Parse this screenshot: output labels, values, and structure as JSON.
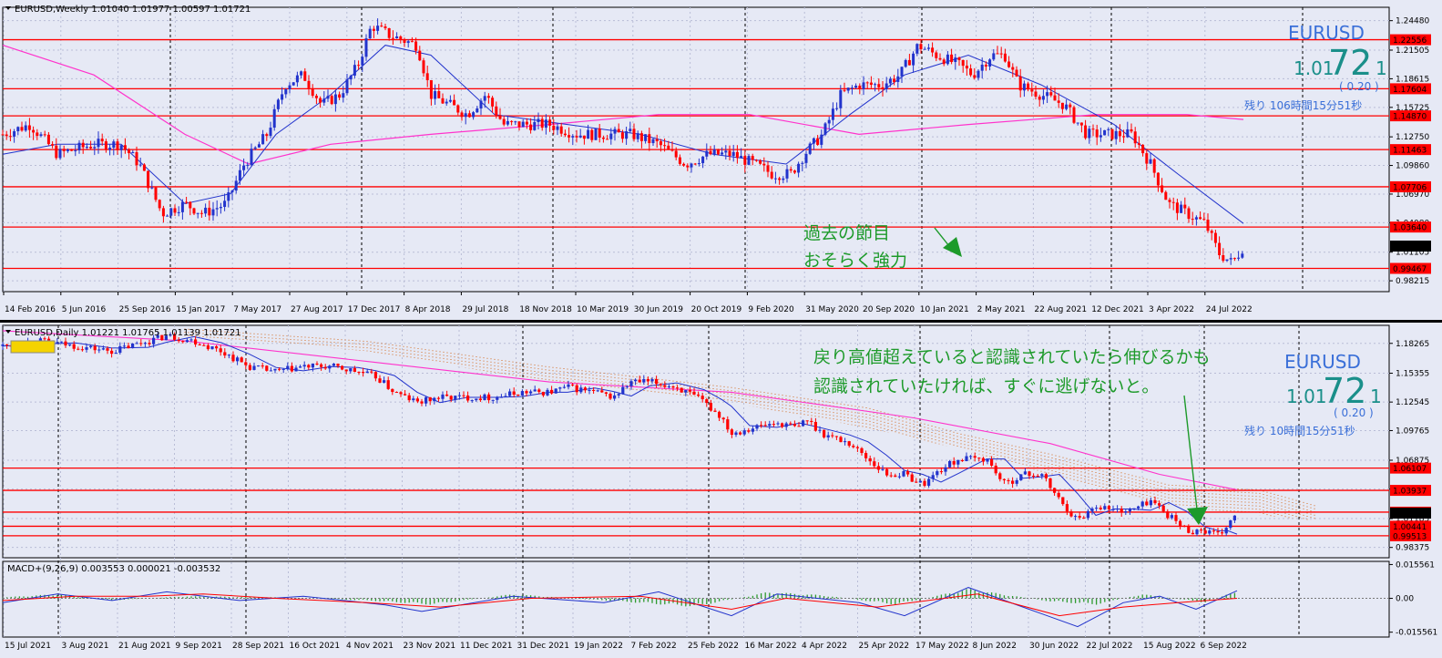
{
  "top_panel": {
    "header": "EURUSD,Weekly  1.01040 1.01977 1.00597 1.01721",
    "symbol": "EURUSD",
    "price_small": "1.01",
    "price_big": "72",
    "price_tail": "1",
    "change": "( 0.20 )",
    "remaining": "残り 106時間15分51秒",
    "annotation_line1": "過去の節目",
    "annotation_line2": "おそらく強力",
    "colors": {
      "levels": "#ff0000",
      "candle_up": "#2233cc",
      "candle_down": "#ff0000",
      "ma_fast": "#2233cc",
      "ma_slow": "#ff33cc",
      "annotation": "#1d9a2a",
      "arrow": "#1d9a2a"
    }
  },
  "bottom_panel": {
    "header": "EURUSD,Daily  1.01221 1.01765 1.01139 1.01721",
    "symbol": "EURUSD",
    "price_small": "1.01",
    "price_big": "72",
    "price_tail": "1",
    "change": "( 0.20 )",
    "remaining": "残り 10時間15分51秒",
    "annotation_line1": "戻り高値超えていると認識されていたら伸びるかも",
    "annotation_line2": "認識されていたければ、すぐに逃げないと。",
    "macd_header": "MACD+(9,26,9) 0.003553 0.000021 -0.003532",
    "colors": {
      "levels": "#ff0000",
      "cloud": "#d2691e",
      "ma": "#ff33cc"
    }
  },
  "chart_data": [
    {
      "type": "candlestick",
      "timeframe": "Weekly",
      "x_tick_labels": [
        "14 Feb 2016",
        "5 Jun 2016",
        "25 Sep 2016",
        "15 Jan 2017",
        "7 May 2017",
        "27 Aug 2017",
        "17 Dec 2017",
        "8 Apr 2018",
        "29 Jul 2018",
        "18 Nov 2018",
        "10 Mar 2019",
        "30 Jun 2019",
        "20 Oct 2019",
        "9 Feb 2020",
        "31 May 2020",
        "20 Sep 2020",
        "10 Jan 2021",
        "2 May 2021",
        "22 Aug 2021",
        "12 Dec 2021",
        "3 Apr 2022",
        "24 Jul 2022"
      ],
      "y_tick_labels": [
        "1.24480",
        "1.21505",
        "1.18615",
        "1.15725",
        "1.12750",
        "1.09860",
        "1.06970",
        "1.04080",
        "1.01105",
        "0.98215"
      ],
      "ylim": [
        0.9712,
        1.2583
      ],
      "level_labels": [
        "1.22556",
        "1.17604",
        "1.14870",
        "1.11463",
        "1.07706",
        "1.03640",
        "0.99467"
      ],
      "current_price_label": "1.01721",
      "close_path": [
        {
          "x": 0,
          "y": 1.13
        },
        {
          "x": 30,
          "y": 1.14
        },
        {
          "x": 60,
          "y": 1.11
        },
        {
          "x": 100,
          "y": 1.12
        },
        {
          "x": 130,
          "y": 1.12
        },
        {
          "x": 150,
          "y": 1.1
        },
        {
          "x": 175,
          "y": 1.05
        },
        {
          "x": 200,
          "y": 1.06
        },
        {
          "x": 220,
          "y": 1.05
        },
        {
          "x": 245,
          "y": 1.06
        },
        {
          "x": 265,
          "y": 1.1
        },
        {
          "x": 290,
          "y": 1.13
        },
        {
          "x": 310,
          "y": 1.18
        },
        {
          "x": 330,
          "y": 1.19
        },
        {
          "x": 350,
          "y": 1.16
        },
        {
          "x": 370,
          "y": 1.17
        },
        {
          "x": 390,
          "y": 1.2
        },
        {
          "x": 405,
          "y": 1.24
        },
        {
          "x": 425,
          "y": 1.23
        },
        {
          "x": 455,
          "y": 1.22
        },
        {
          "x": 470,
          "y": 1.17
        },
        {
          "x": 490,
          "y": 1.16
        },
        {
          "x": 510,
          "y": 1.15
        },
        {
          "x": 530,
          "y": 1.17
        },
        {
          "x": 550,
          "y": 1.14
        },
        {
          "x": 575,
          "y": 1.14
        },
        {
          "x": 600,
          "y": 1.14
        },
        {
          "x": 630,
          "y": 1.13
        },
        {
          "x": 660,
          "y": 1.13
        },
        {
          "x": 690,
          "y": 1.13
        },
        {
          "x": 720,
          "y": 1.12
        },
        {
          "x": 750,
          "y": 1.1
        },
        {
          "x": 775,
          "y": 1.11
        },
        {
          "x": 800,
          "y": 1.11
        },
        {
          "x": 825,
          "y": 1.1
        },
        {
          "x": 845,
          "y": 1.09
        },
        {
          "x": 865,
          "y": 1.09
        },
        {
          "x": 880,
          "y": 1.11
        },
        {
          "x": 900,
          "y": 1.13
        },
        {
          "x": 920,
          "y": 1.17
        },
        {
          "x": 940,
          "y": 1.18
        },
        {
          "x": 965,
          "y": 1.18
        },
        {
          "x": 985,
          "y": 1.19
        },
        {
          "x": 1005,
          "y": 1.22
        },
        {
          "x": 1025,
          "y": 1.21
        },
        {
          "x": 1050,
          "y": 1.2
        },
        {
          "x": 1065,
          "y": 1.19
        },
        {
          "x": 1085,
          "y": 1.21
        },
        {
          "x": 1100,
          "y": 1.21
        },
        {
          "x": 1115,
          "y": 1.18
        },
        {
          "x": 1140,
          "y": 1.17
        },
        {
          "x": 1165,
          "y": 1.16
        },
        {
          "x": 1190,
          "y": 1.13
        },
        {
          "x": 1215,
          "y": 1.13
        },
        {
          "x": 1240,
          "y": 1.13
        },
        {
          "x": 1260,
          "y": 1.1
        },
        {
          "x": 1280,
          "y": 1.06
        },
        {
          "x": 1300,
          "y": 1.05
        },
        {
          "x": 1320,
          "y": 1.04
        },
        {
          "x": 1335,
          "y": 1.01
        },
        {
          "x": 1350,
          "y": 1.0
        },
        {
          "x": 1362,
          "y": 1.017
        }
      ],
      "ma_fast": [
        {
          "x": 0,
          "y": 1.11
        },
        {
          "x": 60,
          "y": 1.12
        },
        {
          "x": 130,
          "y": 1.12
        },
        {
          "x": 200,
          "y": 1.06
        },
        {
          "x": 250,
          "y": 1.07
        },
        {
          "x": 300,
          "y": 1.13
        },
        {
          "x": 360,
          "y": 1.17
        },
        {
          "x": 420,
          "y": 1.22
        },
        {
          "x": 470,
          "y": 1.21
        },
        {
          "x": 540,
          "y": 1.15
        },
        {
          "x": 620,
          "y": 1.14
        },
        {
          "x": 700,
          "y": 1.13
        },
        {
          "x": 780,
          "y": 1.11
        },
        {
          "x": 860,
          "y": 1.1
        },
        {
          "x": 930,
          "y": 1.15
        },
        {
          "x": 990,
          "y": 1.19
        },
        {
          "x": 1060,
          "y": 1.21
        },
        {
          "x": 1140,
          "y": 1.18
        },
        {
          "x": 1220,
          "y": 1.14
        },
        {
          "x": 1290,
          "y": 1.09
        },
        {
          "x": 1362,
          "y": 1.04
        }
      ],
      "ma_slow": [
        {
          "x": 0,
          "y": 1.22
        },
        {
          "x": 100,
          "y": 1.19
        },
        {
          "x": 200,
          "y": 1.13
        },
        {
          "x": 270,
          "y": 1.1
        },
        {
          "x": 360,
          "y": 1.12
        },
        {
          "x": 470,
          "y": 1.13
        },
        {
          "x": 600,
          "y": 1.14
        },
        {
          "x": 720,
          "y": 1.15
        },
        {
          "x": 820,
          "y": 1.15
        },
        {
          "x": 940,
          "y": 1.13
        },
        {
          "x": 1060,
          "y": 1.14
        },
        {
          "x": 1200,
          "y": 1.15
        },
        {
          "x": 1300,
          "y": 1.15
        },
        {
          "x": 1362,
          "y": 1.145
        }
      ]
    },
    {
      "type": "candlestick",
      "timeframe": "Daily",
      "x_tick_labels": [
        "15 Jul 2021",
        "3 Aug 2021",
        "21 Aug 2021",
        "9 Sep 2021",
        "28 Sep 2021",
        "16 Oct 2021",
        "4 Nov 2021",
        "23 Nov 2021",
        "11 Dec 2021",
        "31 Dec 2021",
        "19 Jan 2022",
        "7 Feb 2022",
        "25 Feb 2022",
        "16 Mar 2022",
        "4 Apr 2022",
        "25 Apr 2022",
        "17 May 2022",
        "8 Jun 2022",
        "30 Jun 2022",
        "22 Jul 2022",
        "15 Aug 2022",
        "6 Sep 2022"
      ],
      "y_tick_labels": [
        "1.18265",
        "1.15355",
        "1.12545",
        "1.09765",
        "1.06875",
        "1.04065",
        "1.01185",
        "0.98375"
      ],
      "ylim": [
        0.9737,
        1.2002
      ],
      "level_labels": [
        "1.06107",
        "1.03937",
        "1.01815",
        "1.00441",
        "0.99513"
      ],
      "current_price_label": "1.01721",
      "close_path": [
        {
          "x": 0,
          "y": 1.18
        },
        {
          "x": 40,
          "y": 1.185
        },
        {
          "x": 80,
          "y": 1.18
        },
        {
          "x": 120,
          "y": 1.175
        },
        {
          "x": 160,
          "y": 1.185
        },
        {
          "x": 180,
          "y": 1.19
        },
        {
          "x": 210,
          "y": 1.185
        },
        {
          "x": 240,
          "y": 1.175
        },
        {
          "x": 270,
          "y": 1.16
        },
        {
          "x": 300,
          "y": 1.155
        },
        {
          "x": 330,
          "y": 1.16
        },
        {
          "x": 360,
          "y": 1.16
        },
        {
          "x": 390,
          "y": 1.155
        },
        {
          "x": 410,
          "y": 1.15
        },
        {
          "x": 430,
          "y": 1.135
        },
        {
          "x": 455,
          "y": 1.125
        },
        {
          "x": 480,
          "y": 1.13
        },
        {
          "x": 510,
          "y": 1.13
        },
        {
          "x": 540,
          "y": 1.13
        },
        {
          "x": 570,
          "y": 1.135
        },
        {
          "x": 600,
          "y": 1.135
        },
        {
          "x": 620,
          "y": 1.14
        },
        {
          "x": 650,
          "y": 1.135
        },
        {
          "x": 670,
          "y": 1.13
        },
        {
          "x": 690,
          "y": 1.145
        },
        {
          "x": 710,
          "y": 1.145
        },
        {
          "x": 740,
          "y": 1.14
        },
        {
          "x": 770,
          "y": 1.125
        },
        {
          "x": 790,
          "y": 1.11
        },
        {
          "x": 800,
          "y": 1.095
        },
        {
          "x": 820,
          "y": 1.1
        },
        {
          "x": 850,
          "y": 1.105
        },
        {
          "x": 875,
          "y": 1.1
        },
        {
          "x": 880,
          "y": 1.11
        },
        {
          "x": 900,
          "y": 1.095
        },
        {
          "x": 930,
          "y": 1.085
        },
        {
          "x": 950,
          "y": 1.07
        },
        {
          "x": 970,
          "y": 1.055
        },
        {
          "x": 990,
          "y": 1.055
        },
        {
          "x": 1010,
          "y": 1.045
        },
        {
          "x": 1030,
          "y": 1.06
        },
        {
          "x": 1050,
          "y": 1.07
        },
        {
          "x": 1080,
          "y": 1.07
        },
        {
          "x": 1100,
          "y": 1.045
        },
        {
          "x": 1120,
          "y": 1.055
        },
        {
          "x": 1140,
          "y": 1.055
        },
        {
          "x": 1160,
          "y": 1.03
        },
        {
          "x": 1180,
          "y": 1.01
        },
        {
          "x": 1200,
          "y": 1.025
        },
        {
          "x": 1220,
          "y": 1.02
        },
        {
          "x": 1240,
          "y": 1.02
        },
        {
          "x": 1260,
          "y": 1.03
        },
        {
          "x": 1280,
          "y": 1.015
        },
        {
          "x": 1300,
          "y": 1.0
        },
        {
          "x": 1320,
          "y": 1.0
        },
        {
          "x": 1335,
          "y": 0.995
        },
        {
          "x": 1345,
          "y": 1.005
        },
        {
          "x": 1355,
          "y": 1.017
        }
      ],
      "ma": [
        {
          "x": 0,
          "y": 1.195
        },
        {
          "x": 200,
          "y": 1.185
        },
        {
          "x": 400,
          "y": 1.165
        },
        {
          "x": 600,
          "y": 1.145
        },
        {
          "x": 800,
          "y": 1.135
        },
        {
          "x": 1000,
          "y": 1.11
        },
        {
          "x": 1150,
          "y": 1.085
        },
        {
          "x": 1270,
          "y": 1.055
        },
        {
          "x": 1355,
          "y": 1.04
        }
      ],
      "cloud_top": [
        {
          "x": 200,
          "y": 1.197
        },
        {
          "x": 400,
          "y": 1.185
        },
        {
          "x": 600,
          "y": 1.16
        },
        {
          "x": 800,
          "y": 1.14
        },
        {
          "x": 950,
          "y": 1.12
        },
        {
          "x": 1050,
          "y": 1.095
        },
        {
          "x": 1150,
          "y": 1.075
        },
        {
          "x": 1280,
          "y": 1.045
        },
        {
          "x": 1380,
          "y": 1.04
        },
        {
          "x": 1440,
          "y": 1.025
        }
      ],
      "cloud_bottom": [
        {
          "x": 200,
          "y": 1.19
        },
        {
          "x": 400,
          "y": 1.175
        },
        {
          "x": 600,
          "y": 1.145
        },
        {
          "x": 800,
          "y": 1.125
        },
        {
          "x": 950,
          "y": 1.1
        },
        {
          "x": 1050,
          "y": 1.08
        },
        {
          "x": 1150,
          "y": 1.055
        },
        {
          "x": 1280,
          "y": 1.025
        },
        {
          "x": 1380,
          "y": 1.015
        },
        {
          "x": 1440,
          "y": 1.01
        }
      ]
    },
    {
      "type": "bar",
      "name": "MACD",
      "y_tick_labels": [
        "0.015561",
        "0.00",
        "-0.015561"
      ],
      "ylim": [
        -0.0178,
        0.017
      ],
      "histogram_envelope": [
        {
          "x": 0,
          "y": 0.0005
        },
        {
          "x": 60,
          "y": 0.002
        },
        {
          "x": 120,
          "y": -0.001
        },
        {
          "x": 200,
          "y": 0.001
        },
        {
          "x": 300,
          "y": 0.0005
        },
        {
          "x": 400,
          "y": -0.001
        },
        {
          "x": 470,
          "y": -0.003
        },
        {
          "x": 560,
          "y": 0.002
        },
        {
          "x": 660,
          "y": -0.001
        },
        {
          "x": 760,
          "y": -0.004
        },
        {
          "x": 840,
          "y": 0.003
        },
        {
          "x": 900,
          "y": 0.0015
        },
        {
          "x": 980,
          "y": -0.003
        },
        {
          "x": 1060,
          "y": 0.0045
        },
        {
          "x": 1150,
          "y": -0.0015
        },
        {
          "x": 1200,
          "y": -0.003
        },
        {
          "x": 1250,
          "y": 0.002
        },
        {
          "x": 1320,
          "y": -0.002
        },
        {
          "x": 1355,
          "y": 0.0035
        }
      ],
      "main_line": [
        {
          "x": 0,
          "y": -0.002
        },
        {
          "x": 60,
          "y": 0.002
        },
        {
          "x": 120,
          "y": -0.001
        },
        {
          "x": 180,
          "y": 0.003
        },
        {
          "x": 260,
          "y": -0.001
        },
        {
          "x": 330,
          "y": 0.001
        },
        {
          "x": 420,
          "y": -0.003
        },
        {
          "x": 460,
          "y": -0.006
        },
        {
          "x": 560,
          "y": 0.001
        },
        {
          "x": 660,
          "y": -0.002
        },
        {
          "x": 720,
          "y": 0.003
        },
        {
          "x": 800,
          "y": -0.008
        },
        {
          "x": 850,
          "y": 0.002
        },
        {
          "x": 940,
          "y": -0.002
        },
        {
          "x": 990,
          "y": -0.008
        },
        {
          "x": 1060,
          "y": 0.005
        },
        {
          "x": 1120,
          "y": -0.004
        },
        {
          "x": 1180,
          "y": -0.013
        },
        {
          "x": 1230,
          "y": -0.002
        },
        {
          "x": 1270,
          "y": 0.001
        },
        {
          "x": 1310,
          "y": -0.005
        },
        {
          "x": 1355,
          "y": 0.0035
        }
      ],
      "signal_line": [
        {
          "x": 0,
          "y": -0.001
        },
        {
          "x": 80,
          "y": 0.001
        },
        {
          "x": 160,
          "y": 0.001
        },
        {
          "x": 220,
          "y": 0.002
        },
        {
          "x": 300,
          "y": 0.0
        },
        {
          "x": 400,
          "y": -0.002
        },
        {
          "x": 480,
          "y": -0.004
        },
        {
          "x": 580,
          "y": 0.0
        },
        {
          "x": 700,
          "y": 0.001
        },
        {
          "x": 800,
          "y": -0.005
        },
        {
          "x": 860,
          "y": 0.0
        },
        {
          "x": 960,
          "y": -0.004
        },
        {
          "x": 1070,
          "y": 0.002
        },
        {
          "x": 1160,
          "y": -0.008
        },
        {
          "x": 1230,
          "y": -0.004
        },
        {
          "x": 1290,
          "y": -0.002
        },
        {
          "x": 1355,
          "y": 0.0
        }
      ]
    }
  ]
}
